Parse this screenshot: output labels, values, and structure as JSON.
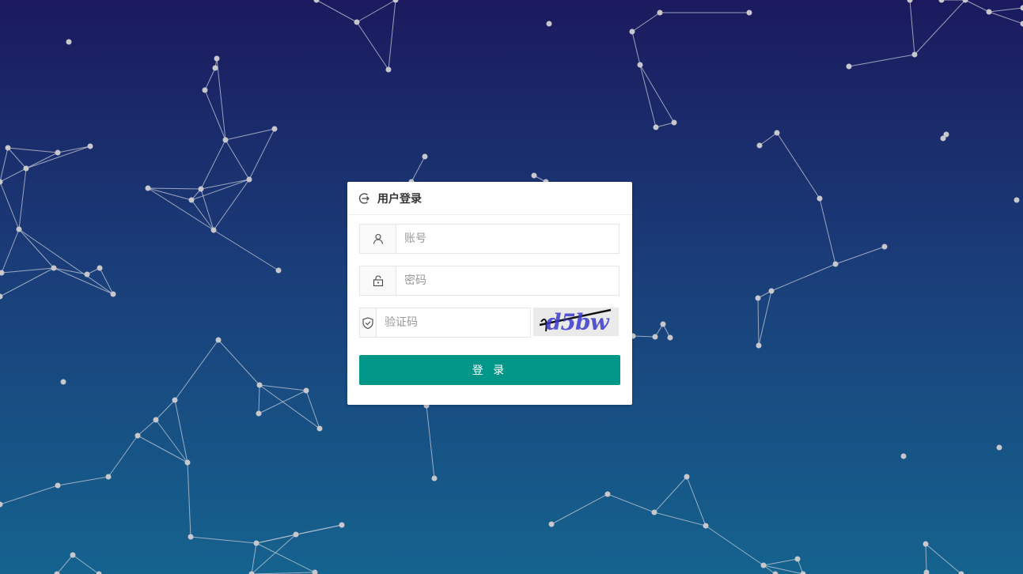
{
  "login": {
    "title": "用户登录",
    "username_placeholder": "账号",
    "password_placeholder": "密码",
    "captcha_placeholder": "验证码",
    "captcha_text": "d5bw",
    "submit_label": "登 录"
  },
  "icons": {
    "header": "login-icon",
    "username": "user-icon",
    "password": "lock-icon",
    "captcha": "shield-check-icon"
  },
  "colors": {
    "gradient_top": "#1b1a5e",
    "gradient_bottom": "#15638f",
    "primary_button": "#009688",
    "particles": "#c8c8cc"
  }
}
